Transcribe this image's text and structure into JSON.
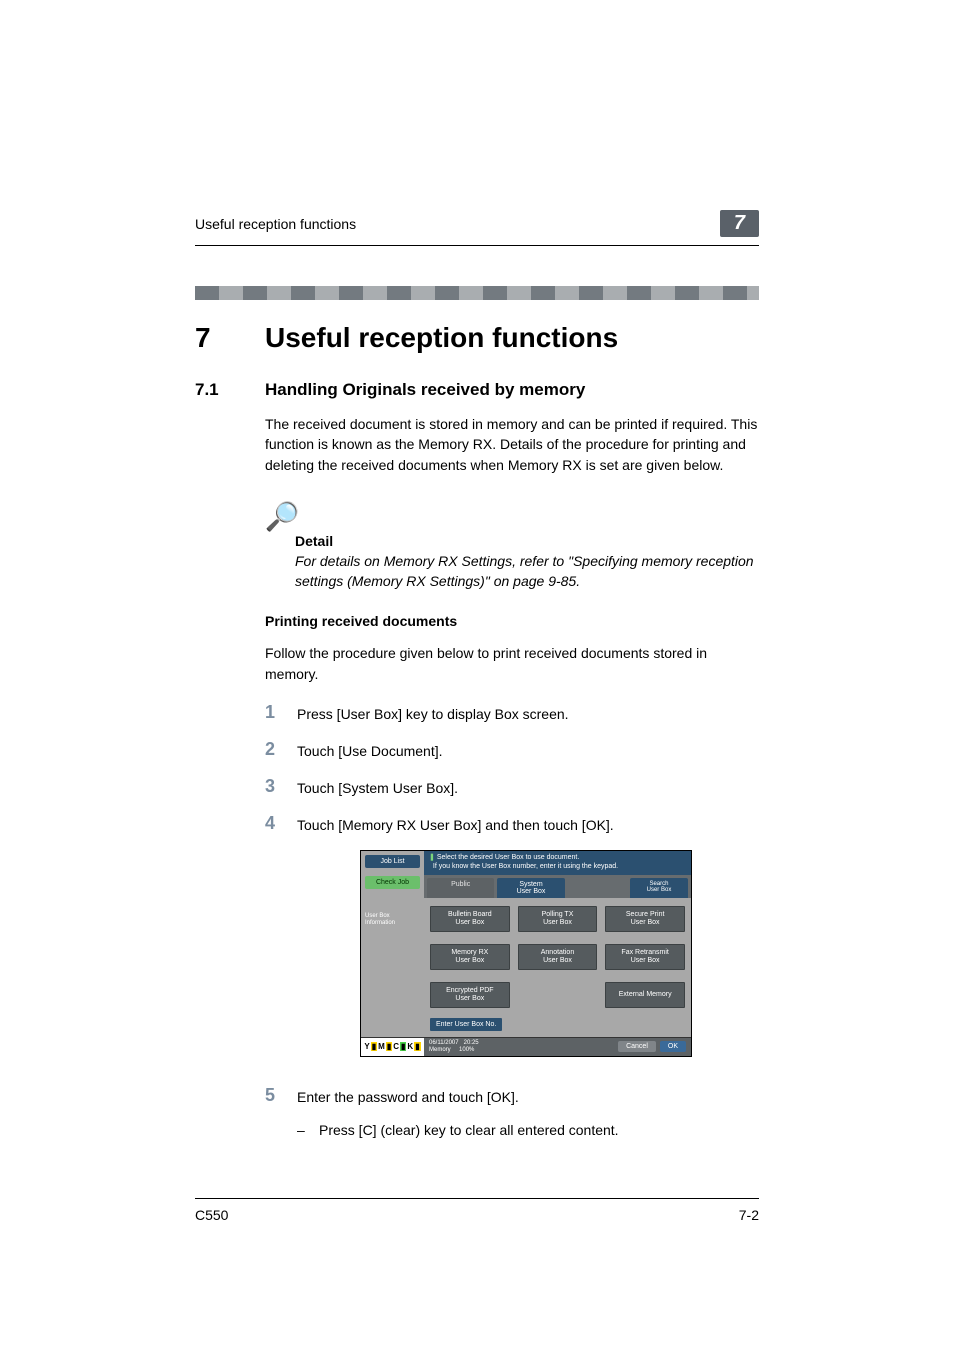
{
  "header": {
    "running_title": "Useful reception functions",
    "chapter_badge": "7"
  },
  "h1": {
    "num": "7",
    "text": "Useful reception functions"
  },
  "h2": {
    "num": "7.1",
    "text": "Handling Originals received by memory"
  },
  "intro": "The received document is stored in memory and can be printed if required. This function is known as the Memory RX. Details of the procedure for printing and deleting the received documents when Memory RX is set are given below.",
  "detail": {
    "label": "Detail",
    "text": "For details on Memory RX Settings, refer to \"Specifying memory reception settings (Memory RX Settings)\" on page 9-85."
  },
  "subhead": "Printing received documents",
  "lead": "Follow the procedure given below to print received documents stored in memory.",
  "steps": [
    {
      "n": "1",
      "t": "Press [User Box] key to display Box screen."
    },
    {
      "n": "2",
      "t": "Touch [Use Document]."
    },
    {
      "n": "3",
      "t": "Touch [System User Box]."
    },
    {
      "n": "4",
      "t": "Touch [Memory RX User Box] and then touch [OK]."
    },
    {
      "n": "5",
      "t": "Enter the password and touch [OK]."
    }
  ],
  "step5_sub": "Press [C] (clear) key to clear all entered content.",
  "screenshot": {
    "left": {
      "job_list": "Job List",
      "check_job": "Check Job",
      "user_box_info": "User Box\nInformation"
    },
    "tip_line1": "Select the desired User Box to use document.",
    "tip_line2": "If you know the User Box number, enter it using the keypad.",
    "tabs": {
      "public": "Public",
      "system": "System\nUser Box",
      "search": "Search\nUser Box"
    },
    "boxes": [
      "Bulletin Board\nUser Box",
      "Polling TX\nUser Box",
      "Secure Print\nUser Box",
      "Memory RX\nUser Box",
      "Annotation\nUser Box",
      "Fax Retransmit\nUser Box",
      "Encrypted PDF\nUser Box",
      "",
      "External Memory"
    ],
    "enter_label": "Enter User Box No.",
    "footer": {
      "date": "06/11/2007",
      "time": "20:25",
      "mem_label": "Memory",
      "mem_val": "100%",
      "cancel": "Cancel",
      "ok": "OK"
    }
  },
  "footer": {
    "model": "C550",
    "page": "7-2"
  }
}
